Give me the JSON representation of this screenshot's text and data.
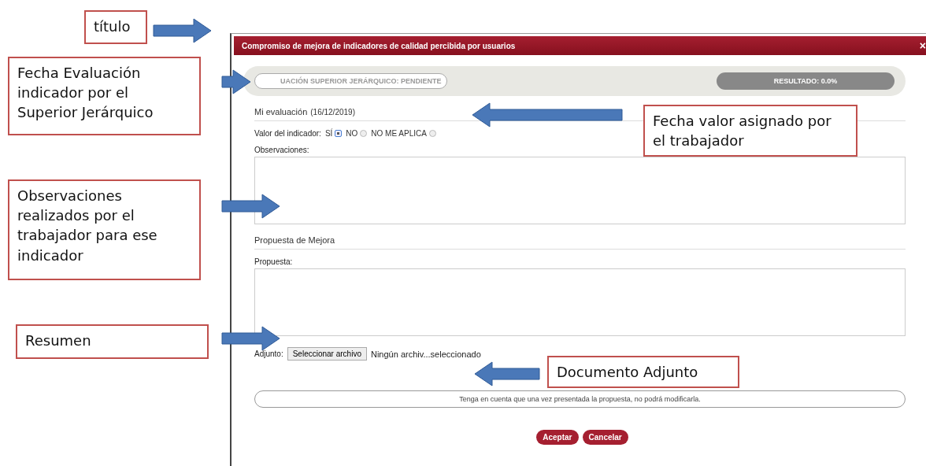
{
  "annotations": [
    {
      "text": "título"
    },
    {
      "text": "Fecha Evaluación indicador  por el Superior Jerárquico"
    },
    {
      "text": "Fecha valor asignado por el trabajador"
    },
    {
      "text": "Observaciones realizados por el trabajador para ese indicador"
    },
    {
      "text": "Resumen"
    },
    {
      "text": "Documento Adjunto"
    }
  ],
  "dialog": {
    "title": "Compromiso de mejora de indicadores de calidad percibida por usuarios",
    "close": "×",
    "status_pill": "UACIÓN SUPERIOR JERÁRQUICO: PENDIENTE",
    "result": "RESULTADO: 0.0%",
    "evaluation_heading": "Mi evaluación",
    "evaluation_date": "(16/12/2019)",
    "indicator_label": "Valor del indicador:",
    "options": [
      {
        "label": "SÍ",
        "selected": true
      },
      {
        "label": "NO",
        "selected": false
      },
      {
        "label": "NO ME APLICA",
        "selected": false
      }
    ],
    "observations_label": "Observaciones:",
    "proposal_heading": "Propuesta de Mejora",
    "proposal_label": "Propuesta:",
    "attachment_label": "Adjunto:",
    "file_button": "Seleccionar archivo",
    "file_status": "Ningún archiv...seleccionado",
    "notice": "Tenga en cuenta que una vez presentada la propuesta, no podrá modificarla.",
    "buttons": [
      {
        "label": "Aceptar"
      },
      {
        "label": "Cancelar"
      }
    ]
  }
}
